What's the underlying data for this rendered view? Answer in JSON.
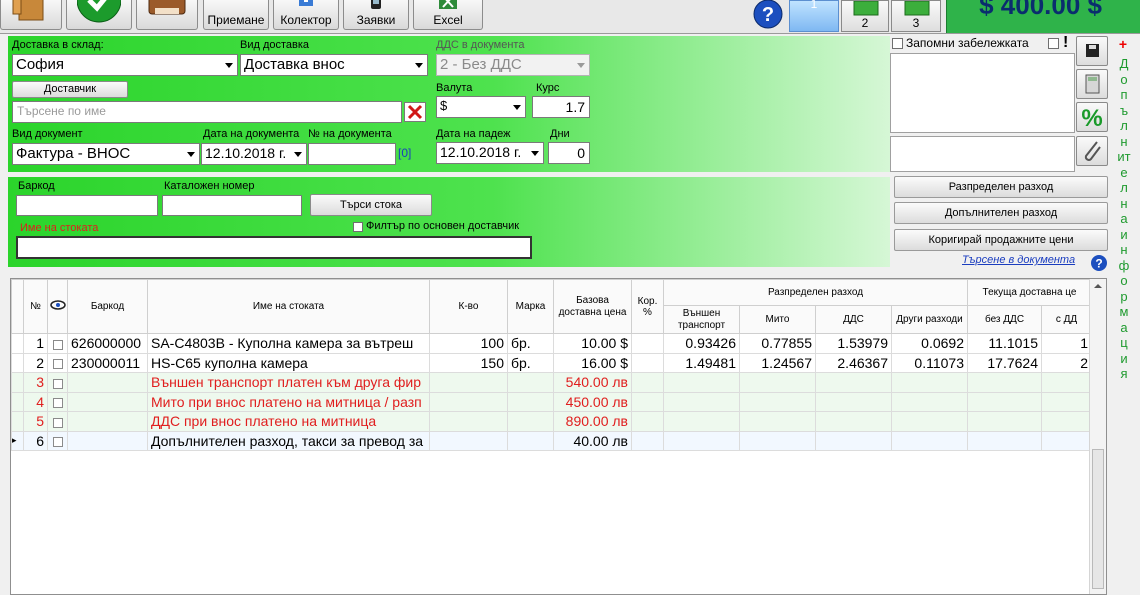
{
  "toolbar": {
    "buttons": [
      {
        "label": "Приемане"
      },
      {
        "label": "Колектор"
      },
      {
        "label": "Заявки"
      },
      {
        "label": "Excel"
      }
    ],
    "help_label": "?",
    "page_tabs": [
      "1",
      "2",
      "3"
    ],
    "total": "$ 400.00 $"
  },
  "header": {
    "warehouse_label": "Доставка в склад:",
    "warehouse_value": "София",
    "delivery_type_label": "Вид доставка",
    "delivery_type_value": "Доставка внос",
    "vat_label": "ДДС в документа",
    "vat_value": "2 - Без ДДС",
    "supplier_button": "Доставчик",
    "supplier_placeholder": "Търсене по име",
    "currency_label": "Валута",
    "currency_value": "$",
    "rate_label": "Курс",
    "rate_value": "1.7",
    "doc_type_label": "Вид документ",
    "doc_type_value": "Фактура - ВНОС",
    "doc_date_label": "Дата на документа",
    "doc_date_value": "12.10.2018 г.",
    "doc_no_label": "№ на документа",
    "doc_no_value": "",
    "doc_no_hint": "[0]",
    "due_date_label": "Дата на падеж",
    "due_date_value": "12.10.2018 г.",
    "days_label": "Дни",
    "days_value": "0"
  },
  "notes": {
    "remember_label": "Запомни забележката",
    "flag_label": "!"
  },
  "side_strip": {
    "plus": "+",
    "text": "Допълнителна информация"
  },
  "search": {
    "barcode_label": "Баркод",
    "catalog_label": "Каталожен номер",
    "search_button": "Търси стока",
    "filter_label": "Филтър по основен доставчик",
    "name_label": "Име на стоката"
  },
  "right_buttons": {
    "distributed": "Разпределен разход",
    "additional": "Допълнителен разход",
    "correct_prices": "Коригирай продажните цени",
    "search_doc": "Търсене в документа"
  },
  "grid": {
    "headers": {
      "no": "№",
      "barcode": "Баркод",
      "name": "Име на стоката",
      "qty": "К-во",
      "unit": "Марка",
      "base_price": "Базова доставна цена",
      "cor": "Кор. %",
      "distributed": "Разпределен разход",
      "transport": "Външен транспорт",
      "customs": "Мито",
      "vat": "ДДС",
      "other": "Други разходи",
      "current": "Текуща доставна це",
      "no_vat": "без ДДС",
      "with_vat": "с ДД"
    },
    "rows": [
      {
        "no": "1",
        "barcode": "626000000",
        "name": "SA-C4803B - Куполна камера за вътреш",
        "qty": "100",
        "unit": "бр.",
        "price": "10.00 $",
        "cor": "",
        "transport": "0.93426",
        "customs": "0.77855",
        "vat": "1.53979",
        "other": "0.0692",
        "no_vat": "11.1015",
        "with_vat": "1",
        "type": "item"
      },
      {
        "no": "2",
        "barcode": "230000011",
        "name": "HS-C65 куполна камера",
        "qty": "150",
        "unit": "бр.",
        "price": "16.00 $",
        "cor": "",
        "transport": "1.49481",
        "customs": "1.24567",
        "vat": "2.46367",
        "other": "0.11073",
        "no_vat": "17.7624",
        "with_vat": "2",
        "type": "item"
      },
      {
        "no": "3",
        "barcode": "",
        "name": "Външен транспорт платен към друга фир",
        "qty": "",
        "unit": "",
        "price": "540.00 лв",
        "cor": "",
        "transport": "",
        "customs": "",
        "vat": "",
        "other": "",
        "no_vat": "",
        "with_vat": "",
        "type": "cost"
      },
      {
        "no": "4",
        "barcode": "",
        "name": "Мито при внос платено на митница / разп",
        "qty": "",
        "unit": "",
        "price": "450.00 лв",
        "cor": "",
        "transport": "",
        "customs": "",
        "vat": "",
        "other": "",
        "no_vat": "",
        "with_vat": "",
        "type": "cost"
      },
      {
        "no": "5",
        "barcode": "",
        "name": "ДДС при внос платено на митница",
        "qty": "",
        "unit": "",
        "price": "890.00 лв",
        "cor": "",
        "transport": "",
        "customs": "",
        "vat": "",
        "other": "",
        "no_vat": "",
        "with_vat": "",
        "type": "cost"
      },
      {
        "no": "6",
        "barcode": "",
        "name": "Допълнителен разход, такси за превод за",
        "qty": "",
        "unit": "",
        "price": "40.00 лв",
        "cor": "",
        "transport": "",
        "customs": "",
        "vat": "",
        "other": "",
        "no_vat": "",
        "with_vat": "",
        "type": "current"
      }
    ]
  },
  "colors": {
    "accent_green": "#2fb34a",
    "header_green": "#2bd42b",
    "cost_text": "#e01e1e",
    "total_text": "#0a2d6e"
  }
}
